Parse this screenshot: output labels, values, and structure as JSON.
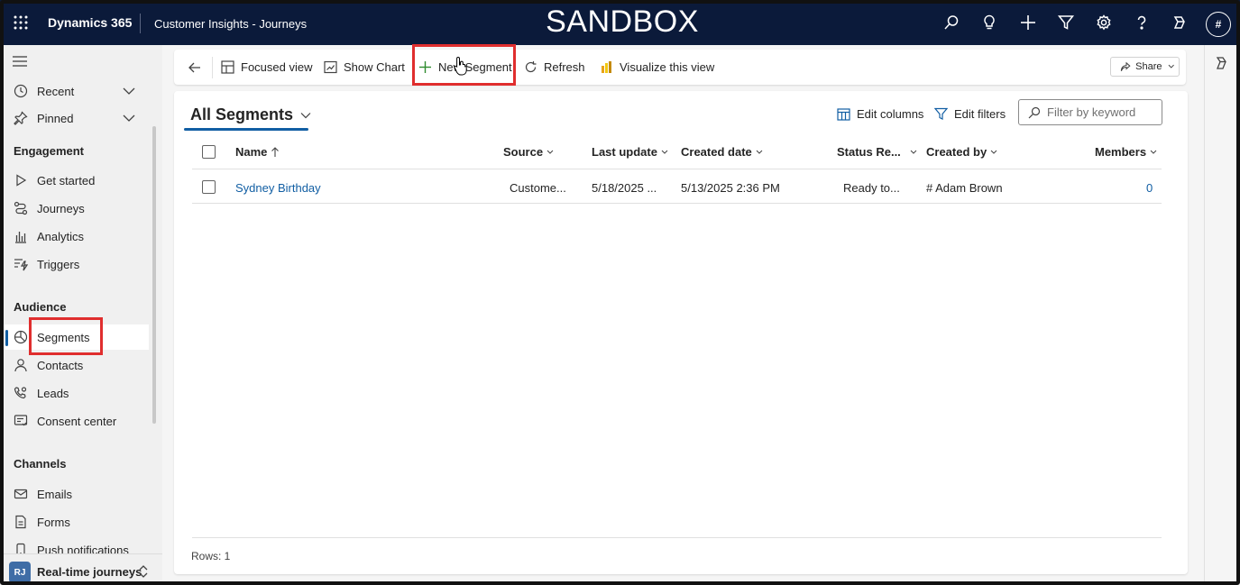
{
  "topbar": {
    "app_name": "Dynamics 365",
    "area_name": "Customer Insights - Journeys",
    "environment_banner": "SANDBOX",
    "avatar_initial": "#",
    "icons": [
      "search-icon",
      "lightbulb-icon",
      "plus-icon",
      "filter-icon",
      "gear-icon",
      "help-icon",
      "copilot-icon"
    ],
    "background_color": "#0b1a3a"
  },
  "sidebar": {
    "recent": "Recent",
    "pinned": "Pinned",
    "groups": {
      "engagement": {
        "title": "Engagement",
        "items": [
          "Get started",
          "Journeys",
          "Analytics",
          "Triggers"
        ]
      },
      "audience": {
        "title": "Audience",
        "items": [
          "Segments",
          "Contacts",
          "Leads",
          "Consent center"
        ]
      },
      "channels": {
        "title": "Channels",
        "items": [
          "Emails",
          "Forms",
          "Push notifications"
        ]
      }
    },
    "selected_item": "Segments",
    "area_switcher": {
      "badge": "RJ",
      "label": "Real-time journeys"
    }
  },
  "commandbar": {
    "focused_view": "Focused view",
    "show_chart": "Show Chart",
    "new_segment": "New Segment",
    "refresh": "Refresh",
    "visualize": "Visualize this view",
    "share": "Share"
  },
  "grid": {
    "view_name": "All Segments",
    "edit_columns": "Edit columns",
    "edit_filters": "Edit filters",
    "filter_placeholder": "Filter by keyword",
    "columns": [
      "Name",
      "Source",
      "Last update",
      "Created date",
      "Status Re...",
      "Created by",
      "Members"
    ],
    "rows": [
      {
        "name": "Sydney Birthday",
        "source": "Custome...",
        "last_update": "5/18/2025 ...",
        "created_date": "5/13/2025 2:36 PM",
        "status": "Ready to...",
        "created_by": "# Adam Brown",
        "members": "0"
      }
    ],
    "rows_label": "Rows: 1"
  },
  "colors": {
    "accent": "#115ea3",
    "highlight": "#e02e2e"
  }
}
